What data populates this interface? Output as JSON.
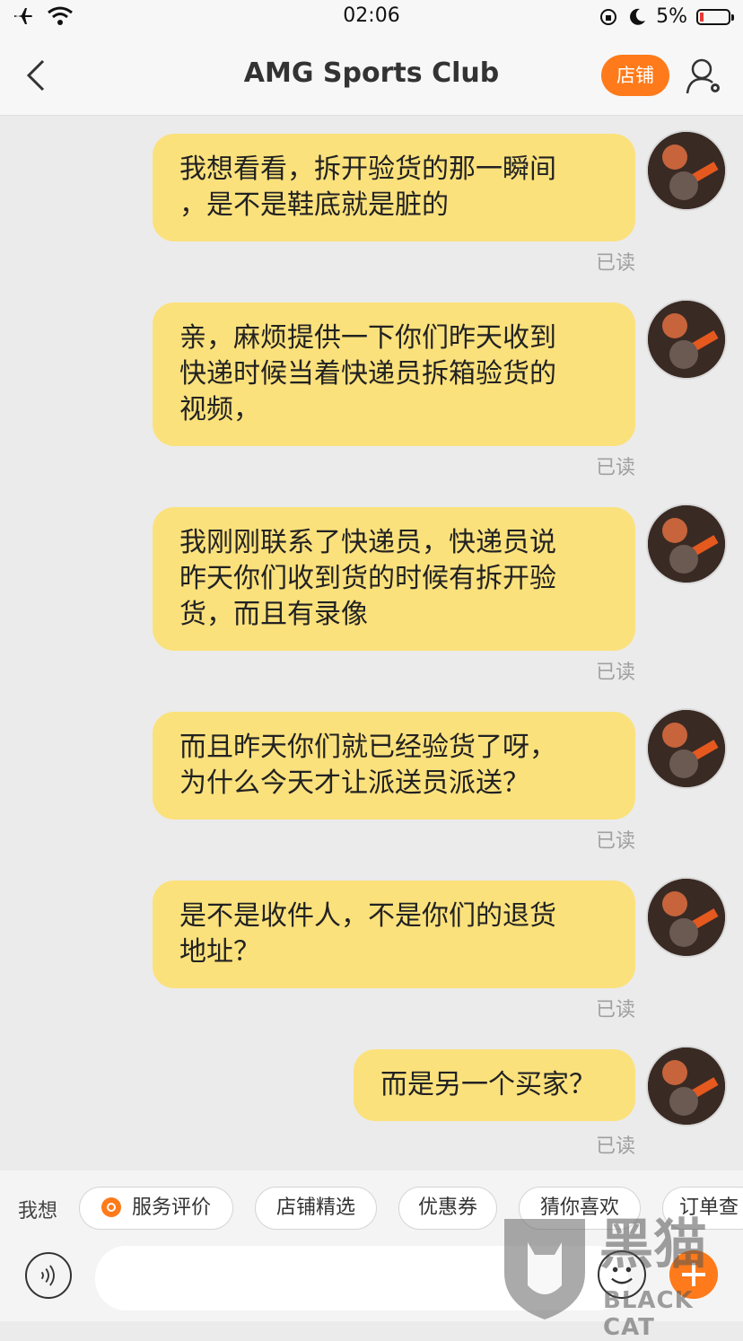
{
  "status": {
    "time": "02:06",
    "battery": "5%"
  },
  "nav": {
    "title": "AMG Sports Club",
    "shop_label": "店铺"
  },
  "messages": [
    {
      "text": "我想看看，拆开验货的那一瞬间\n，是不是鞋底就是脏的",
      "status": "已读"
    },
    {
      "text": "亲，麻烦提供一下你们昨天收到\n快递时候当着快递员拆箱验货的\n视频，",
      "status": "已读"
    },
    {
      "text": "我刚刚联系了快递员，快递员说\n昨天你们收到货的时候有拆开验\n货，而且有录像",
      "status": "已读"
    },
    {
      "text": "而且昨天你们就已经验货了呀，\n为什么今天才让派送员派送？",
      "status": "已读"
    },
    {
      "text": "是不是收件人，不是你们的退货\n地址？",
      "status": "已读"
    },
    {
      "text": "而是另一个买家？",
      "status": "已读"
    }
  ],
  "quick": {
    "label": "我想",
    "chips": [
      "服务评价",
      "店铺精选",
      "优惠券",
      "猜你喜欢",
      "订单查"
    ]
  },
  "watermark": {
    "main": "黑猫",
    "sub": "BLACK CAT"
  },
  "colors": {
    "bubble": "#fbe17c",
    "accent": "#ff7a1a",
    "background": "#ebebeb"
  }
}
